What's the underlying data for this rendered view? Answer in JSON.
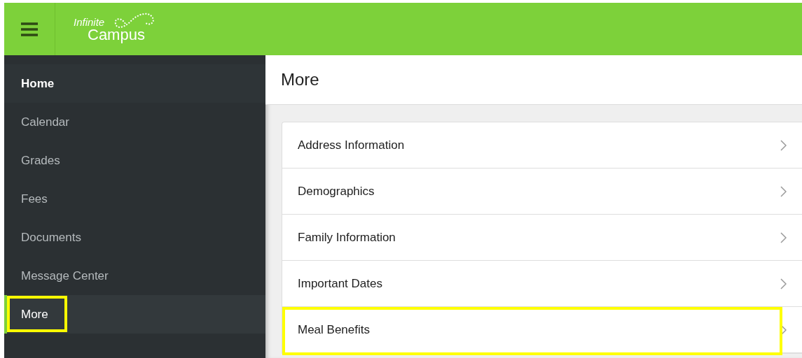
{
  "header": {
    "logo": {
      "line_1": "Infinite",
      "line_2": "Campus"
    }
  },
  "sidebar": {
    "items": [
      {
        "label": "Home",
        "kind": "header",
        "selected": false,
        "highlighted": false
      },
      {
        "label": "Calendar",
        "kind": "link",
        "selected": false,
        "highlighted": false
      },
      {
        "label": "Grades",
        "kind": "link",
        "selected": false,
        "highlighted": false
      },
      {
        "label": "Fees",
        "kind": "link",
        "selected": false,
        "highlighted": false
      },
      {
        "label": "Documents",
        "kind": "link",
        "selected": false,
        "highlighted": false
      },
      {
        "label": "Message Center",
        "kind": "link",
        "selected": false,
        "highlighted": false
      },
      {
        "label": "More",
        "kind": "link",
        "selected": true,
        "highlighted": true
      }
    ]
  },
  "page": {
    "title": "More",
    "items": [
      {
        "label": "Address Information",
        "highlighted": false
      },
      {
        "label": "Demographics",
        "highlighted": false
      },
      {
        "label": "Family Information",
        "highlighted": false
      },
      {
        "label": "Important Dates",
        "highlighted": false
      },
      {
        "label": "Meal Benefits",
        "highlighted": true
      }
    ]
  }
}
